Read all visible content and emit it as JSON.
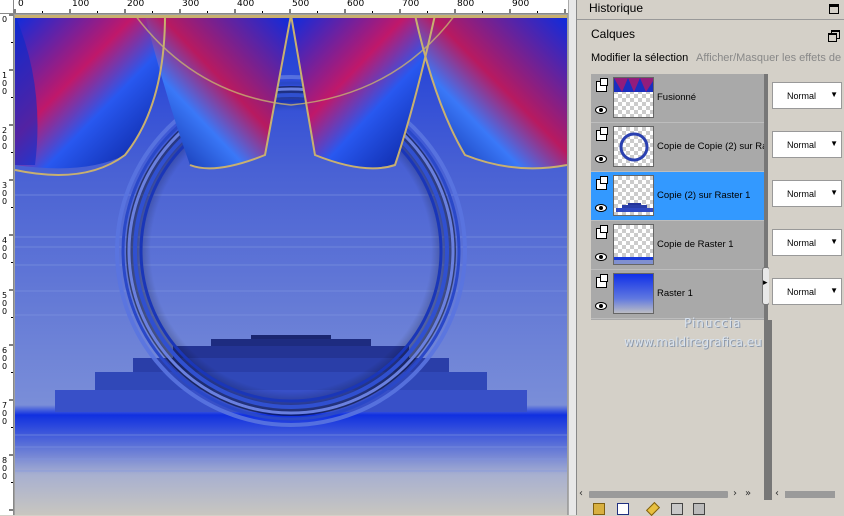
{
  "ruler": {
    "top_labels": [
      "0",
      "100",
      "200",
      "300",
      "400",
      "500",
      "600",
      "700",
      "800",
      "900"
    ],
    "left_labels": [
      "0",
      "1 0 0",
      "2 0 0",
      "3 0 0",
      "4 0 0",
      "5 0 0",
      "6 0 0",
      "7 0 0",
      "8 0 0"
    ]
  },
  "panel": {
    "historique_title": "Historique",
    "calques_title": "Calques",
    "tabs": {
      "modify": "Modifier la sélection",
      "show": "Afficher/Masquer les effets de"
    }
  },
  "layers": [
    {
      "name": "Fusionné",
      "blend": "Normal",
      "selected": false,
      "thumb": "fusion"
    },
    {
      "name": "Copie de Copie (2) sur Ra",
      "blend": "Normal",
      "selected": false,
      "thumb": "ring"
    },
    {
      "name": "Copie (2) sur Raster 1",
      "blend": "Normal",
      "selected": true,
      "thumb": "steps"
    },
    {
      "name": "Copie de Raster 1",
      "blend": "Normal",
      "selected": false,
      "thumb": "band"
    },
    {
      "name": "Raster 1",
      "blend": "Normal",
      "selected": false,
      "thumb": "gradient"
    }
  ],
  "watermark": {
    "line1": "Pinuccia",
    "line2": "www.maldiregrafica.eu"
  },
  "colors": {
    "selected_row": "#3399ff",
    "canvas_blue": "#4a62d4"
  }
}
